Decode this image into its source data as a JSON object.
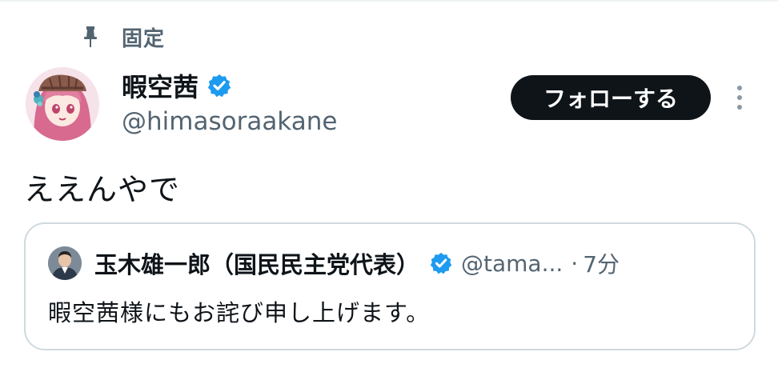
{
  "pinned": {
    "label": "固定",
    "icon": "pin-icon"
  },
  "author": {
    "display_name": "暇空茜",
    "handle": "@himasoraakane",
    "verified": true,
    "verified_color": "#1d9bf0"
  },
  "follow_button": {
    "label": "フォローする"
  },
  "tweet": {
    "text": "ええんやで"
  },
  "quote": {
    "author_name": "玉木雄一郎（国民民主党代表）",
    "author_handle": "@tama...",
    "separator": "·",
    "time": "7分",
    "verified": true,
    "text": "暇空茜様にもお詫び申し上げます。"
  },
  "colors": {
    "primary_text": "#0f1419",
    "secondary_text": "#536471",
    "border": "#cfd9de",
    "button_bg": "#0f1419",
    "verified": "#1d9bf0"
  }
}
